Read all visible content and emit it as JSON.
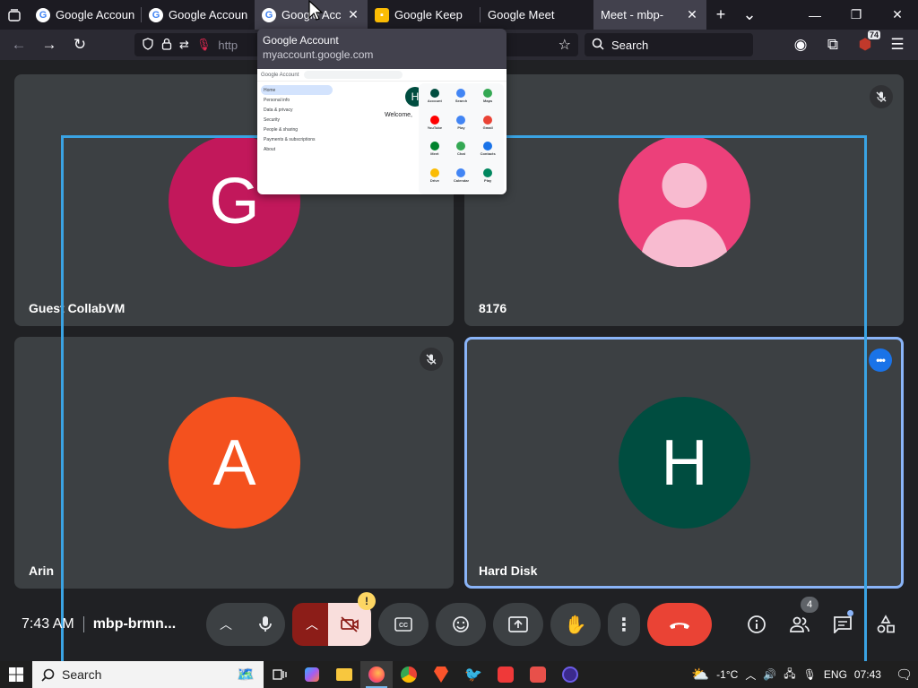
{
  "browser": {
    "tabs": [
      {
        "title": "Google Account",
        "favicon": "google-g-icon",
        "active": false
      },
      {
        "title": "Google Account",
        "favicon": "google-g-icon",
        "active": false
      },
      {
        "title": "Google Accou",
        "favicon": "google-g-icon",
        "active": true
      },
      {
        "title": "Google Keep",
        "favicon": "google-keep-icon",
        "active": false
      },
      {
        "title": "Google Meet",
        "favicon": "google-meet-icon",
        "active": false
      },
      {
        "title": "Meet - mbp-",
        "favicon": "google-meet-icon",
        "active": false
      }
    ],
    "url_text": "http",
    "search_placeholder": "Search",
    "extension_badge": "74"
  },
  "tab_preview": {
    "title": "Google Account",
    "url": "myaccount.google.com",
    "thumb": {
      "header": "Google Account",
      "search": "Search Google Account",
      "welcome": "Welcome,",
      "avatar_letter": "H",
      "side_items": [
        "Home",
        "Personal info",
        "Data & privacy",
        "Security",
        "People & sharing",
        "Payments & subscriptions",
        "About"
      ],
      "apps": [
        "Account",
        "Search",
        "Maps",
        "YouTube",
        "Play",
        "Gmail",
        "Meet",
        "Chat",
        "Contacts",
        "Drive",
        "Calendar",
        "Play"
      ]
    }
  },
  "participants": [
    {
      "name": "Guest CollabVM",
      "initial": "G",
      "color": "#c2185b",
      "muted": false
    },
    {
      "name": "8176",
      "initial": "",
      "color": "#ec407a",
      "muted": true,
      "generic_avatar": true
    },
    {
      "name": "Arin",
      "initial": "A",
      "color": "#f4511e",
      "muted": true
    },
    {
      "name": "Hard Disk",
      "initial": "H",
      "color": "#004d40",
      "muted": false,
      "speaking": true
    }
  ],
  "meeting": {
    "time": "7:43 AM",
    "code": "mbp-brmn...",
    "people_count": "4",
    "camera_warning": "!"
  },
  "taskbar": {
    "search_label": "Search",
    "weather": "-1°C",
    "language": "ENG",
    "clock": "07:43"
  },
  "colors": {
    "accent": "#1a73e8",
    "end_call": "#ea4335",
    "selection": "#3aa3e3",
    "speaking_border": "#8ab4f8"
  }
}
